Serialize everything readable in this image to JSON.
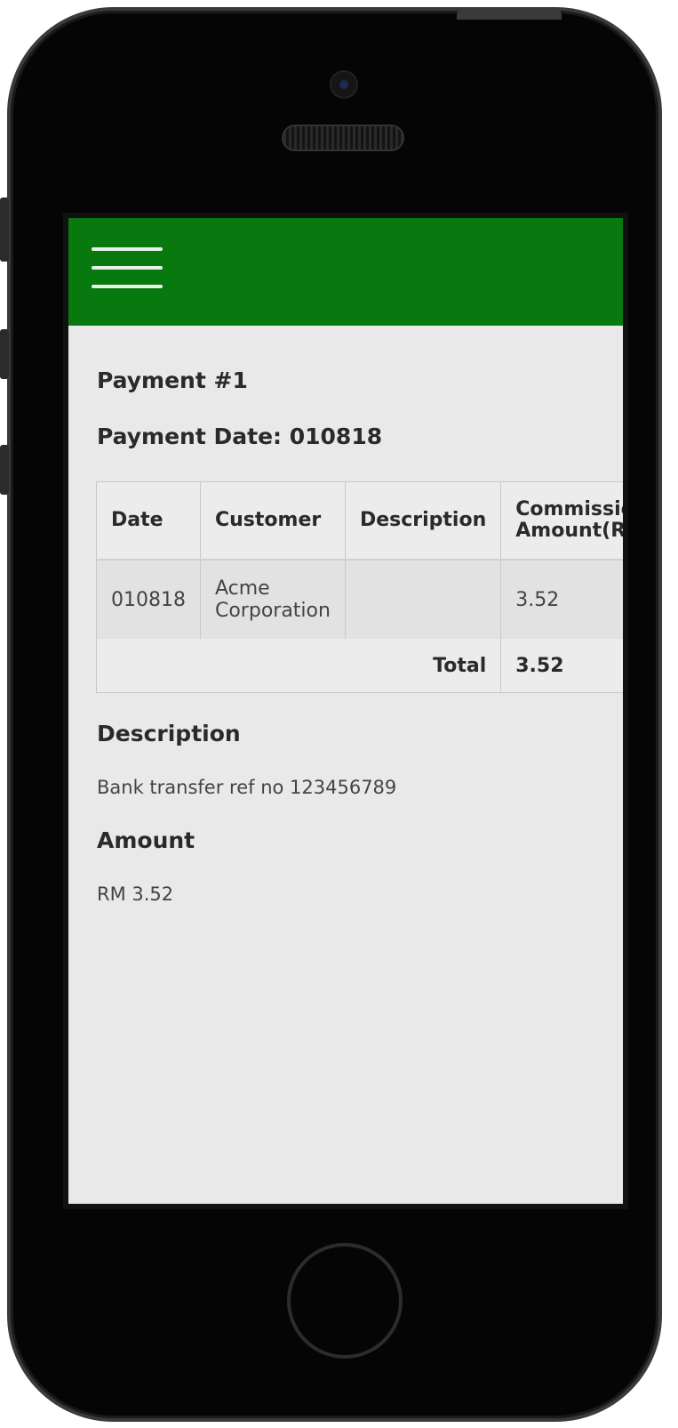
{
  "screen": {
    "payment_title": "Payment #1",
    "payment_date": "Payment Date: 010818",
    "table": {
      "headers": [
        "Date",
        "Customer",
        "Description",
        "Commission Amount(RM)"
      ],
      "rows": [
        {
          "date": "010818",
          "customer": "Acme Corporation",
          "description": "",
          "amount": "3.52"
        }
      ],
      "total_label": "Total",
      "total_value": "3.52"
    },
    "description_heading": "Description",
    "description_text": "Bank transfer ref no 123456789",
    "amount_heading": "Amount",
    "amount_text": "RM 3.52"
  },
  "colors": {
    "appbar": "#08790f",
    "screen_bg": "#e9e9e9"
  },
  "icons": {
    "menu": "hamburger-menu-icon"
  }
}
